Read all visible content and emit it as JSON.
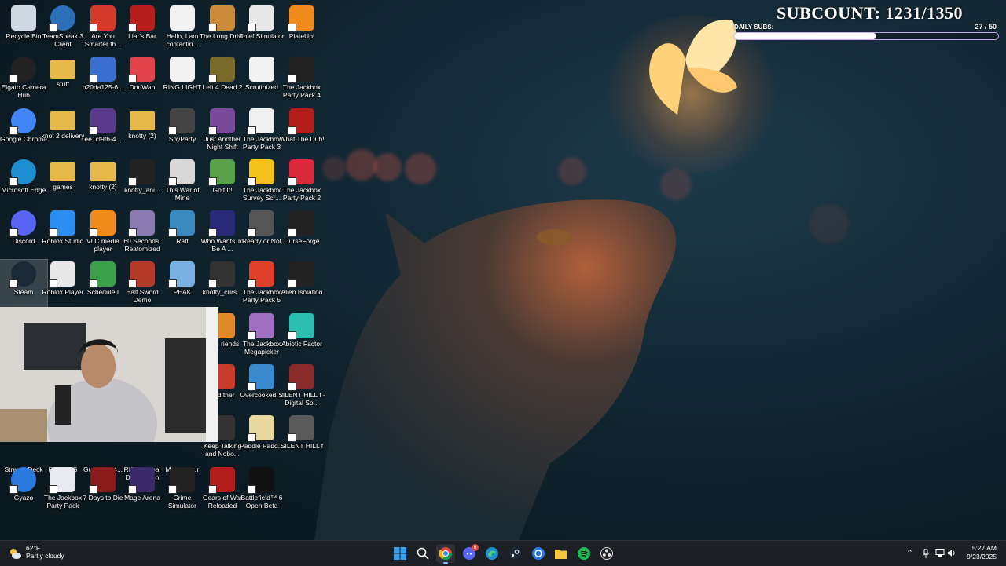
{
  "desktop": {
    "icons": [
      {
        "label": "Recycle Bin",
        "icon": "recycle-bin-icon",
        "color": "#cfd8e0"
      },
      {
        "label": "TeamSpeak 3 Client",
        "icon": "teamspeak-icon",
        "color": "#2a6fb8"
      },
      {
        "label": "Are You Smarter th...",
        "icon": "game-icon",
        "color": "#d43a2a"
      },
      {
        "label": "Liar's Bar",
        "icon": "game-icon",
        "color": "#b51c1c"
      },
      {
        "label": "Hello, I am contactin...",
        "icon": "document-icon",
        "color": "#f2f2f2"
      },
      {
        "label": "The Long Drive",
        "icon": "game-icon",
        "color": "#c98b3a"
      },
      {
        "label": "Thief Simulator",
        "icon": "game-icon",
        "color": "#e8e8e8"
      },
      {
        "label": "PlateUp!",
        "icon": "game-icon",
        "color": "#f08a1a"
      },
      {
        "label": "Elgato Camera Hub",
        "icon": "camera-icon",
        "color": "#222"
      },
      {
        "label": "stuff",
        "icon": "folder-icon",
        "color": "#e6b94a"
      },
      {
        "label": "b20da125-6...",
        "icon": "image-icon",
        "color": "#3a6fd0"
      },
      {
        "label": "DouWan",
        "icon": "app-icon",
        "color": "#e0444a"
      },
      {
        "label": "RING LIGHT",
        "icon": "document-icon",
        "color": "#f2f2f2"
      },
      {
        "label": "Left 4 Dead 2",
        "icon": "game-icon",
        "color": "#7a6a2a"
      },
      {
        "label": "Scrutinized",
        "icon": "document-icon",
        "color": "#f2f2f2"
      },
      {
        "label": "The Jackbox Party Pack 4",
        "icon": "game-icon",
        "color": "#222"
      },
      {
        "label": "Google Chrome",
        "icon": "chrome-icon",
        "color": "#4285f4"
      },
      {
        "label": "knot 2 delivery",
        "icon": "folder-icon",
        "color": "#e6b94a"
      },
      {
        "label": "ee1cf9fb-4...",
        "icon": "image-icon",
        "color": "#5a3a8a"
      },
      {
        "label": "knotty (2)",
        "icon": "folder-icon",
        "color": "#e6b94a"
      },
      {
        "label": "SpyParty",
        "icon": "game-icon",
        "color": "#444"
      },
      {
        "label": "Just Another Night Shift",
        "icon": "game-icon",
        "color": "#7a4a9a"
      },
      {
        "label": "The Jackbox Party Pack 3",
        "icon": "game-icon",
        "color": "#f0f0f0"
      },
      {
        "label": "What The Dub!",
        "icon": "game-icon",
        "color": "#b51c1c"
      },
      {
        "label": "Microsoft Edge",
        "icon": "edge-icon",
        "color": "#1e8fd0"
      },
      {
        "label": "games",
        "icon": "folder-icon",
        "color": "#e6b94a"
      },
      {
        "label": "knotty (2)",
        "icon": "folder-icon",
        "color": "#e6b94a"
      },
      {
        "label": "knotty_ani...",
        "icon": "video-icon",
        "color": "#222"
      },
      {
        "label": "This War of Mine",
        "icon": "game-icon",
        "color": "#d8d8d8"
      },
      {
        "label": "Golf It!",
        "icon": "game-icon",
        "color": "#5aa04a"
      },
      {
        "label": "The Jackbox Survey Scr...",
        "icon": "game-icon",
        "color": "#f2c21a"
      },
      {
        "label": "The Jackbox Party Pack 2",
        "icon": "game-icon",
        "color": "#d82a3a"
      },
      {
        "label": "Discord",
        "icon": "discord-icon",
        "color": "#5865f2"
      },
      {
        "label": "Roblox Studio",
        "icon": "roblox-studio-icon",
        "color": "#2a8ff0"
      },
      {
        "label": "VLC media player",
        "icon": "vlc-icon",
        "color": "#f08a1a"
      },
      {
        "label": "60 Seconds! Reatomized",
        "icon": "game-icon",
        "color": "#8a7ab0"
      },
      {
        "label": "Raft",
        "icon": "game-icon",
        "color": "#3a8ac0"
      },
      {
        "label": "Who Wants To Be A ...",
        "icon": "game-icon",
        "color": "#2a2a7a"
      },
      {
        "label": "Ready or Not",
        "icon": "game-icon",
        "color": "#555"
      },
      {
        "label": "CurseForge",
        "icon": "curseforge-icon",
        "color": "#222"
      },
      {
        "label": "Steam",
        "icon": "steam-icon",
        "color": "#1b2838"
      },
      {
        "label": "Roblox Player",
        "icon": "roblox-icon",
        "color": "#e8e8e8"
      },
      {
        "label": "Schedule I",
        "icon": "game-icon",
        "color": "#3aa04a"
      },
      {
        "label": "Half Sword Demo",
        "icon": "game-icon",
        "color": "#b53a2a"
      },
      {
        "label": "PEAK",
        "icon": "game-icon",
        "color": "#7ab0e0"
      },
      {
        "label": "knotty_curs...",
        "icon": "file-icon",
        "color": "#333"
      },
      {
        "label": "The Jackbox Party Pack 5",
        "icon": "game-icon",
        "color": "#e0402a"
      },
      {
        "label": "Alien Isolation",
        "icon": "game-icon",
        "color": "#222"
      },
      {
        "label": "With riends",
        "icon": "game-icon",
        "color": "#e08a2a"
      },
      {
        "label": "The Jackbox Megapicker",
        "icon": "game-icon",
        "color": "#a070c0"
      },
      {
        "label": "Abiotic Factor",
        "icon": "game-icon",
        "color": "#2ac0b0"
      },
      {
        "label": "ned ther",
        "icon": "game-icon",
        "color": "#c83a2a"
      },
      {
        "label": "Overcooked! 2",
        "icon": "game-icon",
        "color": "#3a8ad0"
      },
      {
        "label": "SILENT HILL f - Digital So...",
        "icon": "game-icon",
        "color": "#8a2a2a"
      },
      {
        "label": "Keep Talking and Nobo...",
        "icon": "game-icon",
        "color": "#333"
      },
      {
        "label": "Paddle Padd...",
        "icon": "game-icon",
        "color": "#e8d8a0"
      },
      {
        "label": "SILENT HILL f",
        "icon": "game-icon",
        "color": "#5a5a5a"
      },
      {
        "label": "Stream Deck",
        "icon": "app-icon",
        "color": "#333"
      },
      {
        "label": "ROUNDS",
        "icon": "game-icon",
        "color": "#333"
      },
      {
        "label": "GuyJones4...",
        "icon": "file-icon",
        "color": "#333"
      },
      {
        "label": "RISK Global Domination",
        "icon": "game-icon",
        "color": "#333"
      },
      {
        "label": "Mount Your Friends",
        "icon": "game-icon",
        "color": "#333"
      },
      {
        "label": "Gyazo",
        "icon": "gyazo-icon",
        "color": "#2a7ae0"
      },
      {
        "label": "The Jackbox Party Pack",
        "icon": "game-icon",
        "color": "#e8e8f0"
      },
      {
        "label": "7 Days to Die",
        "icon": "game-icon",
        "color": "#8a1a1a"
      },
      {
        "label": "Mage Arena",
        "icon": "game-icon",
        "color": "#3a2a6a"
      },
      {
        "label": "Crime Simulator",
        "icon": "game-icon",
        "color": "#222"
      },
      {
        "label": "Gears of War Reloaded",
        "icon": "game-icon",
        "color": "#b51c1c"
      },
      {
        "label": "Battlefield™ 6 Open Beta",
        "icon": "game-icon",
        "color": "#111"
      }
    ]
  },
  "overlay": {
    "subcount_text": "SUBCOUNT: 1231/1350",
    "daily_label": "DAILY SUBS:",
    "daily_value": "27 / 50",
    "daily_progress": 0.54
  },
  "taskbar": {
    "weather_temp": "62°F",
    "weather_desc": "Partly cloudy",
    "apps": [
      {
        "name": "start-button",
        "icon": "windows-icon"
      },
      {
        "name": "search-button",
        "icon": "search-icon"
      },
      {
        "name": "chrome-taskbar",
        "icon": "chrome-icon",
        "active": true
      },
      {
        "name": "discord-taskbar",
        "icon": "discord-icon",
        "badge": "6"
      },
      {
        "name": "edge-taskbar",
        "icon": "edge-icon"
      },
      {
        "name": "steam-taskbar",
        "icon": "steam-icon"
      },
      {
        "name": "gyazo-taskbar",
        "icon": "gyazo-icon"
      },
      {
        "name": "file-explorer-taskbar",
        "icon": "folder-icon"
      },
      {
        "name": "spotify-taskbar",
        "icon": "spotify-icon"
      },
      {
        "name": "obs-taskbar",
        "icon": "obs-icon"
      }
    ],
    "time": "5:27 AM",
    "date": "9/23/2025"
  }
}
